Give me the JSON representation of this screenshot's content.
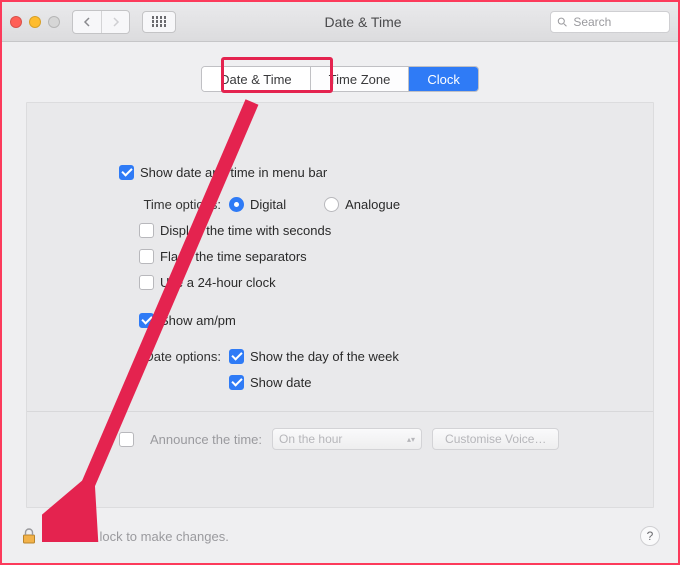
{
  "window": {
    "title": "Date & Time"
  },
  "search": {
    "placeholder": "Search",
    "value": ""
  },
  "tabs": {
    "date_time": "Date & Time",
    "time_zone": "Time Zone",
    "clock": "Clock",
    "selected": "Date & Time"
  },
  "options": {
    "show_in_menu_bar": {
      "label": "Show date and time in menu bar",
      "checked": true
    },
    "time_options_label": "Time options:",
    "time_format": {
      "digital": "Digital",
      "analogue": "Analogue",
      "selected": "Digital"
    },
    "display_seconds": {
      "label": "Display the time with seconds",
      "checked": false
    },
    "flash_separators": {
      "label": "Flash the time separators",
      "checked": false
    },
    "use_24h": {
      "label": "Use a 24-hour clock",
      "checked": false
    },
    "show_ampm": {
      "label": "Show am/pm",
      "checked": true
    },
    "date_options_label": "Date options:",
    "show_day_of_week": {
      "label": "Show the day of the week",
      "checked": true
    },
    "show_date": {
      "label": "Show date",
      "checked": true
    },
    "announce": {
      "label": "Announce the time:",
      "checked": false
    },
    "announce_interval": "On the hour",
    "customise_voice": "Customise Voice…"
  },
  "footer": {
    "lock_text": "Click the lock to make changes."
  },
  "colors": {
    "accent": "#2f7bf6",
    "annotation": "#e4234f"
  }
}
